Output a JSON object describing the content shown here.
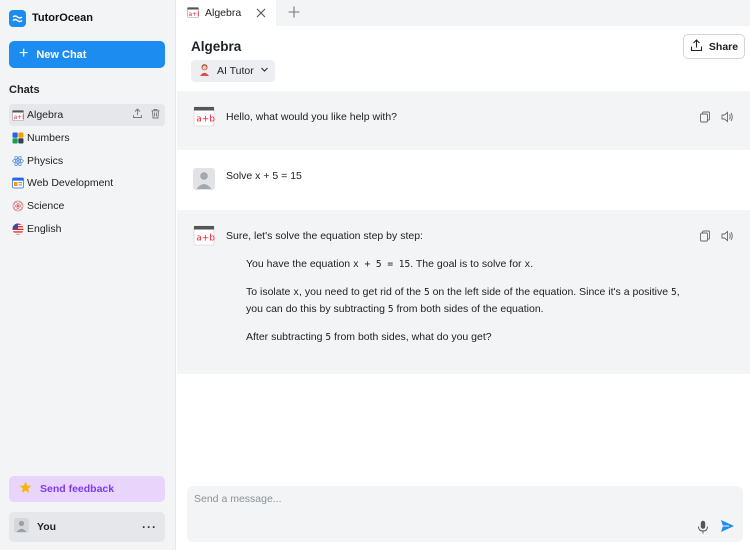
{
  "app": {
    "name": "TutorOcean"
  },
  "sidebar": {
    "new_chat_label": "New Chat",
    "chats_title": "Chats",
    "items": [
      {
        "label": "Algebra",
        "icon": "algebra-icon"
      },
      {
        "label": "Numbers",
        "icon": "numbers-icon"
      },
      {
        "label": "Physics",
        "icon": "atom-icon"
      },
      {
        "label": "Web Development",
        "icon": "browser-icon"
      },
      {
        "label": "Science",
        "icon": "science-icon"
      },
      {
        "label": "English",
        "icon": "us-flag-icon"
      }
    ],
    "feedback_label": "Send feedback",
    "user_label": "You",
    "user_menu": "···"
  },
  "tabs": [
    {
      "label": "Algebra"
    }
  ],
  "header": {
    "title": "Algebra",
    "share_label": "Share",
    "tutor_label": "AI Tutor"
  },
  "messages": [
    {
      "role": "ai",
      "text": "Hello, what would you like help with?"
    },
    {
      "role": "user",
      "text": "Solve x + 5 = 15"
    },
    {
      "role": "ai",
      "intro": "Sure, let's solve the equation step by step:",
      "p1": {
        "a": "You have the equation ",
        "eq": "x + 5 = 15",
        "b": ". The goal is to solve for ",
        "var": "x",
        "c": "."
      },
      "p2": {
        "a": "To isolate ",
        "var": "x",
        "b": ", you need to get rid of the ",
        "n1": "5",
        "c": " on the left side of the equation. Since it's a positive ",
        "n2": "5",
        "d": ",",
        "line2a": "you can do this by subtracting ",
        "n3": "5",
        "line2b": " from both sides of the equation."
      },
      "p3": {
        "a": "After subtracting ",
        "n": "5",
        "b": " from both sides, what do you get?"
      }
    }
  ],
  "composer": {
    "placeholder": "Send a message..."
  },
  "colors": {
    "accent": "#1d8cf0",
    "feedback_bg": "#e9d5fb",
    "feedback_text": "#7c3aed"
  }
}
